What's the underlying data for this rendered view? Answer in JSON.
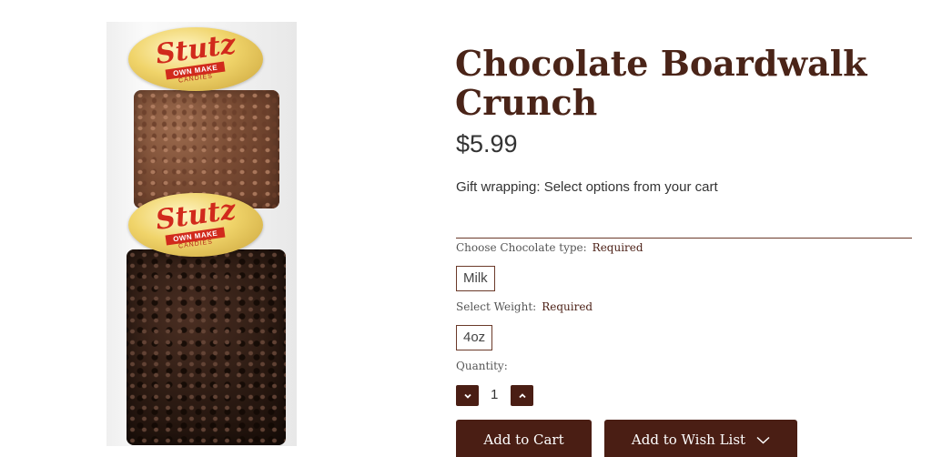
{
  "product": {
    "title": "Chocolate Boardwalk Crunch",
    "price": "$5.99",
    "gift_wrapping": "Gift wrapping: Select options from your cart",
    "image": {
      "brand_label": "Stutz",
      "label_ribbon": "OWN MAKE",
      "label_sub": "CANDIES"
    }
  },
  "options": {
    "chocolate_type": {
      "label": "Choose Chocolate type:",
      "required": "Required",
      "selected": "Milk"
    },
    "weight": {
      "label": "Select Weight:",
      "required": "Required",
      "selected": "4oz"
    }
  },
  "quantity": {
    "label": "Quantity:",
    "value": "1"
  },
  "actions": {
    "add_to_cart": "Add to Cart",
    "add_to_wishlist": "Add to Wish List"
  },
  "colors": {
    "brand_dark": "#4a1e14",
    "title": "#4a2418"
  },
  "icons": {
    "decrement": "chevron-down-icon",
    "increment": "chevron-up-icon",
    "wishlist_dropdown": "chevron-down-icon"
  }
}
